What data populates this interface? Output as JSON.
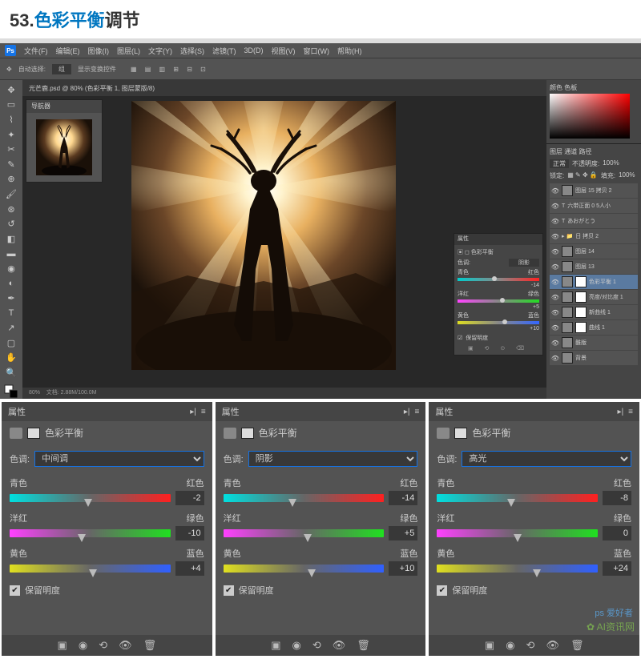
{
  "header": {
    "number": "53.",
    "blue": "色彩平衡",
    "rest": "调节"
  },
  "menubar": [
    "文件(F)",
    "编辑(E)",
    "图像(I)",
    "图层(L)",
    "文字(Y)",
    "选择(S)",
    "滤镜(T)",
    "3D(D)",
    "视图(V)",
    "窗口(W)",
    "帮助(H)"
  ],
  "options": {
    "autoSelect": "自动选择:",
    "group": "组",
    "showTransform": "显示变换控件"
  },
  "tab": "光芒鹿.psd @ 80% (色彩平衡 1, 图层蒙版/8)",
  "navigator": {
    "title": "导航器"
  },
  "zoom": "80%",
  "status": "文档: 2.88M/100.0M",
  "smallProps": {
    "title": "属性",
    "name": "色彩平衡",
    "toneLabel": "色调:",
    "tone": "阴影",
    "rows": [
      {
        "l": "青色",
        "r": "红色",
        "v": "-14"
      },
      {
        "l": "洋红",
        "r": "绿色",
        "v": "+5"
      },
      {
        "l": "黄色",
        "r": "蓝色",
        "v": "+10"
      }
    ],
    "preserve": "保留明度"
  },
  "colorTab": "颜色   色板",
  "layersTab": "图层   通道   路径",
  "layerMode": "正常",
  "opacityLabel": "不透明度:",
  "lockLabel": "锁定:",
  "fillLabel": "填充:",
  "pct": "100%",
  "layers": [
    {
      "name": "图层 15 拷贝 2",
      "t": "white"
    },
    {
      "name": "六带正面 0 5人小",
      "t": "text",
      "prefix": "T"
    },
    {
      "name": "あおがとう",
      "t": "text",
      "prefix": "T"
    },
    {
      "name": "日 拷贝 2",
      "t": "group",
      "prefix": "▸ 📁"
    },
    {
      "name": "图层 14",
      "t": "img"
    },
    {
      "name": "图层 13",
      "t": "img"
    },
    {
      "name": "色彩平衡 1",
      "t": "adj",
      "sel": true
    },
    {
      "name": "亮度/对比度 1",
      "t": "adj"
    },
    {
      "name": "新曲线 1",
      "t": "adj"
    },
    {
      "name": "曲线 1",
      "t": "adj"
    },
    {
      "name": "雒版",
      "t": "img"
    },
    {
      "name": "背景",
      "t": "bg"
    }
  ],
  "panels": [
    {
      "head": "属性",
      "name": "色彩平衡",
      "toneLabel": "色调:",
      "tone": "中间调",
      "sliders": [
        {
          "l": "青色",
          "r": "红色",
          "v": -2,
          "cls": "t-cr"
        },
        {
          "l": "洋红",
          "r": "绿色",
          "v": -10,
          "cls": "t-mg"
        },
        {
          "l": "黄色",
          "r": "蓝色",
          "v": 4,
          "cls": "t-yb"
        }
      ],
      "preserve": "保留明度"
    },
    {
      "head": "属性",
      "name": "色彩平衡",
      "toneLabel": "色调:",
      "tone": "阴影",
      "sliders": [
        {
          "l": "青色",
          "r": "红色",
          "v": -14,
          "cls": "t-cr"
        },
        {
          "l": "洋红",
          "r": "绿色",
          "v": 5,
          "cls": "t-mg"
        },
        {
          "l": "黄色",
          "r": "蓝色",
          "v": 10,
          "cls": "t-yb"
        }
      ],
      "preserve": "保留明度"
    },
    {
      "head": "属性",
      "name": "色彩平衡",
      "toneLabel": "色调:",
      "tone": "高光",
      "sliders": [
        {
          "l": "青色",
          "r": "红色",
          "v": -8,
          "cls": "t-cr"
        },
        {
          "l": "洋红",
          "r": "绿色",
          "v": 0,
          "cls": "t-mg"
        },
        {
          "l": "黄色",
          "r": "蓝色",
          "v": 24,
          "cls": "t-yb"
        }
      ],
      "preserve": "保留明度",
      "watermark": "AI资讯网",
      "watermark2": "ps 爱好者"
    }
  ],
  "chart_data": {
    "type": "table",
    "title": "色彩平衡 (Color Balance) settings",
    "columns": [
      "Tone",
      "Cyan-Red",
      "Magenta-Green",
      "Yellow-Blue",
      "Preserve Luminosity"
    ],
    "rows": [
      [
        "中间调 (Midtones)",
        -2,
        -10,
        4,
        true
      ],
      [
        "阴影 (Shadows)",
        -14,
        5,
        10,
        true
      ],
      [
        "高光 (Highlights)",
        -8,
        0,
        24,
        true
      ]
    ],
    "range": [
      -100,
      100
    ]
  }
}
